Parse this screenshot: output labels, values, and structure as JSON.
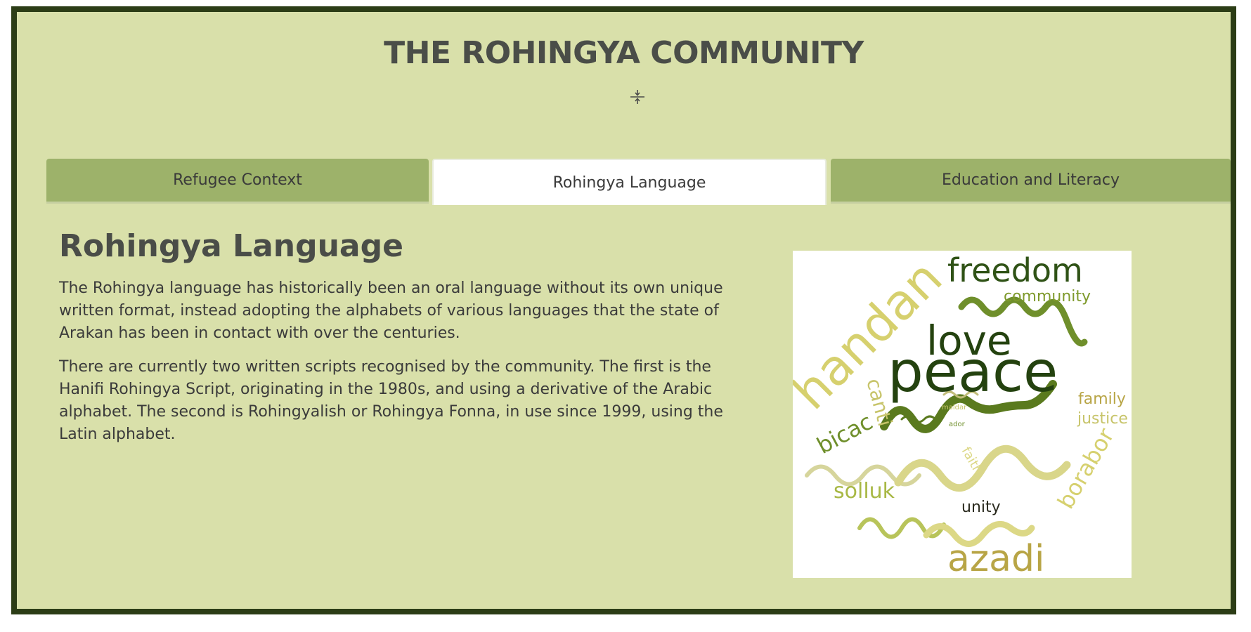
{
  "header": {
    "title": "THE ROHINGYA COMMUNITY",
    "toggle_icon": "collapse-expand-icon"
  },
  "tabs": [
    {
      "label": "Refugee Context",
      "active": false
    },
    {
      "label": "Rohingya Language",
      "active": true
    },
    {
      "label": "Education and Literacy",
      "active": false
    }
  ],
  "content": {
    "heading": "Rohingya Language",
    "paragraphs": [
      "The Rohingya language has historically been an oral language without its own unique written format, instead adopting the alphabets of various languages that the state of Arakan has been in contact with over the centuries.",
      "There are currently two written scripts recognised by the community. The first is the Hanifi Rohingya Script, originating in the 1980s, and using a derivative of the Arabic alphabet. The second is Rohingyalish or Rohingya Fonna, in use since 1999, using the Latin alphabet."
    ]
  },
  "wordcloud": {
    "words": [
      "freedom",
      "community",
      "love",
      "peace",
      "handan",
      "family",
      "justice",
      "canti",
      "bicac",
      "maldar",
      "ador",
      "faith",
      "solluk",
      "borabor",
      "unity",
      "azadi"
    ]
  },
  "colors": {
    "frame_border": "#2c3d16",
    "background": "#d9e0aa",
    "tab_inactive": "#9db26a",
    "tab_active": "#ffffff",
    "text_dark": "#4a4d48"
  }
}
